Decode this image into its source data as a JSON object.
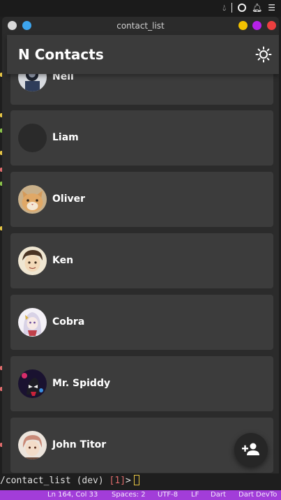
{
  "window": {
    "title": "contact_list"
  },
  "appbar": {
    "title": "N Contacts",
    "theme_icon": "sun-icon"
  },
  "contacts": [
    {
      "name": "Neil",
      "avatar": "portrait-avatar-icon"
    },
    {
      "name": "Liam",
      "avatar": "empty-avatar"
    },
    {
      "name": "Oliver",
      "avatar": "cat-avatar-icon"
    },
    {
      "name": "Ken",
      "avatar": "anime-face-avatar-icon"
    },
    {
      "name": "Cobra",
      "avatar": "anime-girl-avatar-icon"
    },
    {
      "name": "Mr. Spiddy",
      "avatar": "spider-avatar-icon"
    },
    {
      "name": "John Titor",
      "avatar": "anime-boy-avatar-icon"
    }
  ],
  "fab": {
    "icon": "add-person-icon"
  },
  "terminal": {
    "path": "/contact_list",
    "branch": "(dev)",
    "job": "[1]",
    "prompt": ">"
  },
  "statusbar": {
    "position": "Ln 164, Col 33",
    "spaces": "Spaces: 2",
    "encoding": "UTF-8",
    "eol": "LF",
    "language": "Dart",
    "devtools": "Dart DevTo"
  },
  "colors": {
    "background": "#2b2b2b",
    "card": "#3c3c3c",
    "appbar": "#3b3b3b",
    "statusbar": "#a23dd9",
    "window_min": "#f2c200",
    "window_max": "#b621e8",
    "window_close": "#ec3f3f"
  }
}
